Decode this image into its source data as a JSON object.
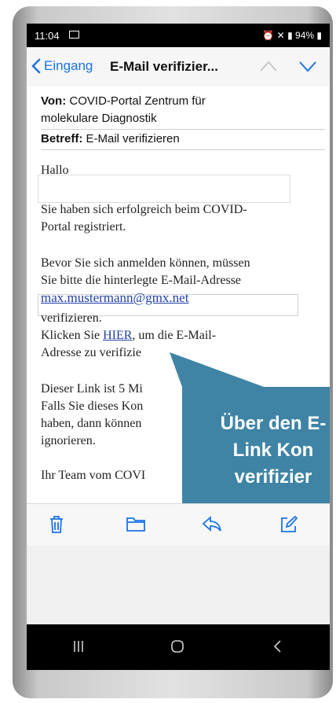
{
  "status": {
    "time": "11:04",
    "battery": "94%",
    "icons": [
      "gallery-icon",
      "alarm-icon",
      "mute-icon",
      "signal-icon",
      "battery-icon"
    ]
  },
  "nav": {
    "back_label": "Eingang",
    "title": "E-Mail verifizier..."
  },
  "mail": {
    "from_label": "Von:",
    "from_value": "COVID-Portal Zentrum für",
    "from_value2": "molekulare Diagnostik",
    "subject_label": "Betreff:",
    "subject_value": "E-Mail verifizieren",
    "greeting": "Hallo",
    "p1_line1": "Sie haben sich erfolgreich beim COVID-",
    "p1_line2": "Portal registriert.",
    "p2_line1": "Bevor Sie sich anmelden können, müssen",
    "p2_line2": "Sie bitte die hinterlegte E-Mail-Adresse",
    "email": "max.mustermann@gmx.net",
    "p2_line4": "verifizieren.",
    "p3_prefix": "Klicken Sie",
    "link_text": "HIER",
    "p3_suffix": ", um die E-Mail-",
    "p3_line2": "Adresse zu verifizie",
    "p4_line1": "Dieser Link ist 5 Mi",
    "p4_line2": "Falls Sie dieses Kon",
    "p4_line3": "haben, dann können",
    "p4_line4": "ignorieren.",
    "signature": "Ihr Team vom COVI"
  },
  "callout": {
    "line1": "Über den E-",
    "line2": "Link Kon",
    "line3": "verifizier"
  },
  "colors": {
    "accent": "#1a73e8",
    "callout": "#3f84a4",
    "link": "#1f3fa6"
  },
  "toolbar_icons": [
    "trash-icon",
    "folder-icon",
    "reply-icon",
    "compose-icon"
  ],
  "sysnav_icons": [
    "recents-icon",
    "home-icon",
    "back-icon"
  ]
}
